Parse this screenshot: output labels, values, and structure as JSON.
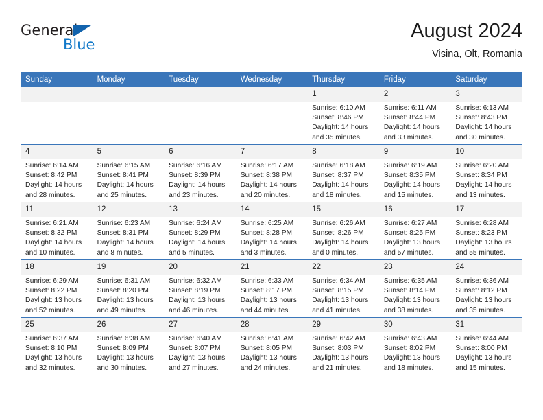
{
  "brand": {
    "name_top": "General",
    "name_bottom": "Blue",
    "color_dark": "#231f20",
    "color_blue": "#1279c9"
  },
  "header": {
    "title": "August 2024",
    "subtitle": "Visina, Olt, Romania"
  },
  "theme": {
    "header_blue": "#3a76ba",
    "daynum_band": "#f2f2f2",
    "text": "#222222"
  },
  "weekday_headers": [
    "Sunday",
    "Monday",
    "Tuesday",
    "Wednesday",
    "Thursday",
    "Friday",
    "Saturday"
  ],
  "weeks": [
    [
      {
        "day": "",
        "sunrise": "",
        "sunset": "",
        "daylight_line1": "",
        "daylight_line2": ""
      },
      {
        "day": "",
        "sunrise": "",
        "sunset": "",
        "daylight_line1": "",
        "daylight_line2": ""
      },
      {
        "day": "",
        "sunrise": "",
        "sunset": "",
        "daylight_line1": "",
        "daylight_line2": ""
      },
      {
        "day": "",
        "sunrise": "",
        "sunset": "",
        "daylight_line1": "",
        "daylight_line2": ""
      },
      {
        "day": "1",
        "sunrise": "Sunrise: 6:10 AM",
        "sunset": "Sunset: 8:46 PM",
        "daylight_line1": "Daylight: 14 hours",
        "daylight_line2": "and 35 minutes."
      },
      {
        "day": "2",
        "sunrise": "Sunrise: 6:11 AM",
        "sunset": "Sunset: 8:44 PM",
        "daylight_line1": "Daylight: 14 hours",
        "daylight_line2": "and 33 minutes."
      },
      {
        "day": "3",
        "sunrise": "Sunrise: 6:13 AM",
        "sunset": "Sunset: 8:43 PM",
        "daylight_line1": "Daylight: 14 hours",
        "daylight_line2": "and 30 minutes."
      }
    ],
    [
      {
        "day": "4",
        "sunrise": "Sunrise: 6:14 AM",
        "sunset": "Sunset: 8:42 PM",
        "daylight_line1": "Daylight: 14 hours",
        "daylight_line2": "and 28 minutes."
      },
      {
        "day": "5",
        "sunrise": "Sunrise: 6:15 AM",
        "sunset": "Sunset: 8:41 PM",
        "daylight_line1": "Daylight: 14 hours",
        "daylight_line2": "and 25 minutes."
      },
      {
        "day": "6",
        "sunrise": "Sunrise: 6:16 AM",
        "sunset": "Sunset: 8:39 PM",
        "daylight_line1": "Daylight: 14 hours",
        "daylight_line2": "and 23 minutes."
      },
      {
        "day": "7",
        "sunrise": "Sunrise: 6:17 AM",
        "sunset": "Sunset: 8:38 PM",
        "daylight_line1": "Daylight: 14 hours",
        "daylight_line2": "and 20 minutes."
      },
      {
        "day": "8",
        "sunrise": "Sunrise: 6:18 AM",
        "sunset": "Sunset: 8:37 PM",
        "daylight_line1": "Daylight: 14 hours",
        "daylight_line2": "and 18 minutes."
      },
      {
        "day": "9",
        "sunrise": "Sunrise: 6:19 AM",
        "sunset": "Sunset: 8:35 PM",
        "daylight_line1": "Daylight: 14 hours",
        "daylight_line2": "and 15 minutes."
      },
      {
        "day": "10",
        "sunrise": "Sunrise: 6:20 AM",
        "sunset": "Sunset: 8:34 PM",
        "daylight_line1": "Daylight: 14 hours",
        "daylight_line2": "and 13 minutes."
      }
    ],
    [
      {
        "day": "11",
        "sunrise": "Sunrise: 6:21 AM",
        "sunset": "Sunset: 8:32 PM",
        "daylight_line1": "Daylight: 14 hours",
        "daylight_line2": "and 10 minutes."
      },
      {
        "day": "12",
        "sunrise": "Sunrise: 6:23 AM",
        "sunset": "Sunset: 8:31 PM",
        "daylight_line1": "Daylight: 14 hours",
        "daylight_line2": "and 8 minutes."
      },
      {
        "day": "13",
        "sunrise": "Sunrise: 6:24 AM",
        "sunset": "Sunset: 8:29 PM",
        "daylight_line1": "Daylight: 14 hours",
        "daylight_line2": "and 5 minutes."
      },
      {
        "day": "14",
        "sunrise": "Sunrise: 6:25 AM",
        "sunset": "Sunset: 8:28 PM",
        "daylight_line1": "Daylight: 14 hours",
        "daylight_line2": "and 3 minutes."
      },
      {
        "day": "15",
        "sunrise": "Sunrise: 6:26 AM",
        "sunset": "Sunset: 8:26 PM",
        "daylight_line1": "Daylight: 14 hours",
        "daylight_line2": "and 0 minutes."
      },
      {
        "day": "16",
        "sunrise": "Sunrise: 6:27 AM",
        "sunset": "Sunset: 8:25 PM",
        "daylight_line1": "Daylight: 13 hours",
        "daylight_line2": "and 57 minutes."
      },
      {
        "day": "17",
        "sunrise": "Sunrise: 6:28 AM",
        "sunset": "Sunset: 8:23 PM",
        "daylight_line1": "Daylight: 13 hours",
        "daylight_line2": "and 55 minutes."
      }
    ],
    [
      {
        "day": "18",
        "sunrise": "Sunrise: 6:29 AM",
        "sunset": "Sunset: 8:22 PM",
        "daylight_line1": "Daylight: 13 hours",
        "daylight_line2": "and 52 minutes."
      },
      {
        "day": "19",
        "sunrise": "Sunrise: 6:31 AM",
        "sunset": "Sunset: 8:20 PM",
        "daylight_line1": "Daylight: 13 hours",
        "daylight_line2": "and 49 minutes."
      },
      {
        "day": "20",
        "sunrise": "Sunrise: 6:32 AM",
        "sunset": "Sunset: 8:19 PM",
        "daylight_line1": "Daylight: 13 hours",
        "daylight_line2": "and 46 minutes."
      },
      {
        "day": "21",
        "sunrise": "Sunrise: 6:33 AM",
        "sunset": "Sunset: 8:17 PM",
        "daylight_line1": "Daylight: 13 hours",
        "daylight_line2": "and 44 minutes."
      },
      {
        "day": "22",
        "sunrise": "Sunrise: 6:34 AM",
        "sunset": "Sunset: 8:15 PM",
        "daylight_line1": "Daylight: 13 hours",
        "daylight_line2": "and 41 minutes."
      },
      {
        "day": "23",
        "sunrise": "Sunrise: 6:35 AM",
        "sunset": "Sunset: 8:14 PM",
        "daylight_line1": "Daylight: 13 hours",
        "daylight_line2": "and 38 minutes."
      },
      {
        "day": "24",
        "sunrise": "Sunrise: 6:36 AM",
        "sunset": "Sunset: 8:12 PM",
        "daylight_line1": "Daylight: 13 hours",
        "daylight_line2": "and 35 minutes."
      }
    ],
    [
      {
        "day": "25",
        "sunrise": "Sunrise: 6:37 AM",
        "sunset": "Sunset: 8:10 PM",
        "daylight_line1": "Daylight: 13 hours",
        "daylight_line2": "and 32 minutes."
      },
      {
        "day": "26",
        "sunrise": "Sunrise: 6:38 AM",
        "sunset": "Sunset: 8:09 PM",
        "daylight_line1": "Daylight: 13 hours",
        "daylight_line2": "and 30 minutes."
      },
      {
        "day": "27",
        "sunrise": "Sunrise: 6:40 AM",
        "sunset": "Sunset: 8:07 PM",
        "daylight_line1": "Daylight: 13 hours",
        "daylight_line2": "and 27 minutes."
      },
      {
        "day": "28",
        "sunrise": "Sunrise: 6:41 AM",
        "sunset": "Sunset: 8:05 PM",
        "daylight_line1": "Daylight: 13 hours",
        "daylight_line2": "and 24 minutes."
      },
      {
        "day": "29",
        "sunrise": "Sunrise: 6:42 AM",
        "sunset": "Sunset: 8:03 PM",
        "daylight_line1": "Daylight: 13 hours",
        "daylight_line2": "and 21 minutes."
      },
      {
        "day": "30",
        "sunrise": "Sunrise: 6:43 AM",
        "sunset": "Sunset: 8:02 PM",
        "daylight_line1": "Daylight: 13 hours",
        "daylight_line2": "and 18 minutes."
      },
      {
        "day": "31",
        "sunrise": "Sunrise: 6:44 AM",
        "sunset": "Sunset: 8:00 PM",
        "daylight_line1": "Daylight: 13 hours",
        "daylight_line2": "and 15 minutes."
      }
    ]
  ]
}
